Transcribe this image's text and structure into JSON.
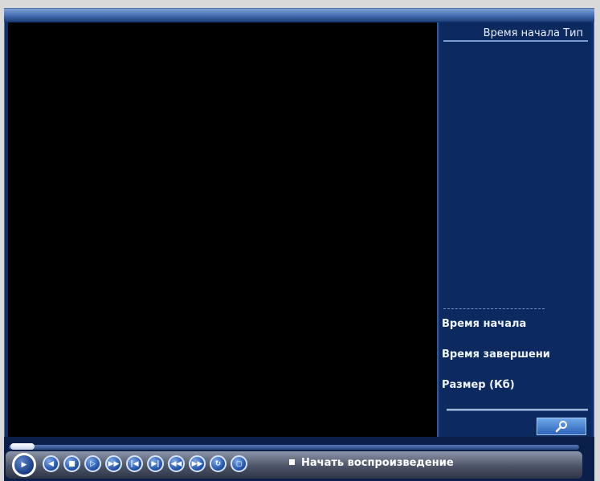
{
  "sidebar": {
    "list_header": "Время начала Тип",
    "labels": {
      "start_time": "Время начала",
      "end_time": "Время завершени",
      "size": "Размер (Кб)"
    },
    "search_icon": "search-icon"
  },
  "controls": {
    "status_text": "Начать воспроизведение",
    "buttons": [
      {
        "name": "play",
        "glyph": "▶"
      },
      {
        "name": "rewind",
        "glyph": "◀"
      },
      {
        "name": "stop",
        "glyph": "■"
      },
      {
        "name": "frame-step",
        "glyph": "▷"
      },
      {
        "name": "fast-forward",
        "glyph": "▶▶"
      },
      {
        "name": "prev",
        "glyph": "|◀"
      },
      {
        "name": "next",
        "glyph": "▶|"
      },
      {
        "name": "slow-backward",
        "glyph": "◀◀"
      },
      {
        "name": "slow-forward",
        "glyph": "▶▶"
      },
      {
        "name": "loop",
        "glyph": "↻"
      },
      {
        "name": "snapshot",
        "glyph": "◻"
      }
    ],
    "progress": 0.03
  },
  "colors": {
    "frame": "#0f2f66",
    "accent": "#2d63b8",
    "video_bg": "#000000"
  }
}
